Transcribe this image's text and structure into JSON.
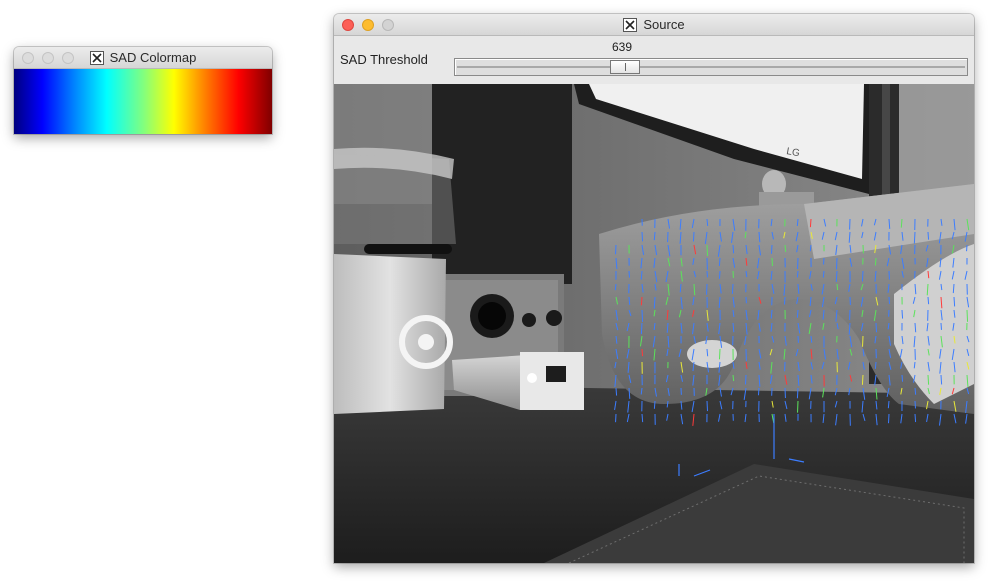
{
  "colormap_window": {
    "title": "SAD Colormap"
  },
  "source_window": {
    "title": "Source",
    "trackbar": {
      "label": "SAD Threshold",
      "value": "639",
      "min": 0,
      "max": 2000
    }
  },
  "camera_frame": {
    "monitor_brand": "LG"
  },
  "colors": {
    "colormap_stops": [
      "#00007f",
      "#0000ff",
      "#00ffff",
      "#ffff00",
      "#ff0000",
      "#7f0000"
    ],
    "vector_blue": "#3c7dff",
    "vector_green": "#5be25b",
    "vector_yellow": "#e8e83a",
    "vector_red": "#ff3a3a"
  }
}
